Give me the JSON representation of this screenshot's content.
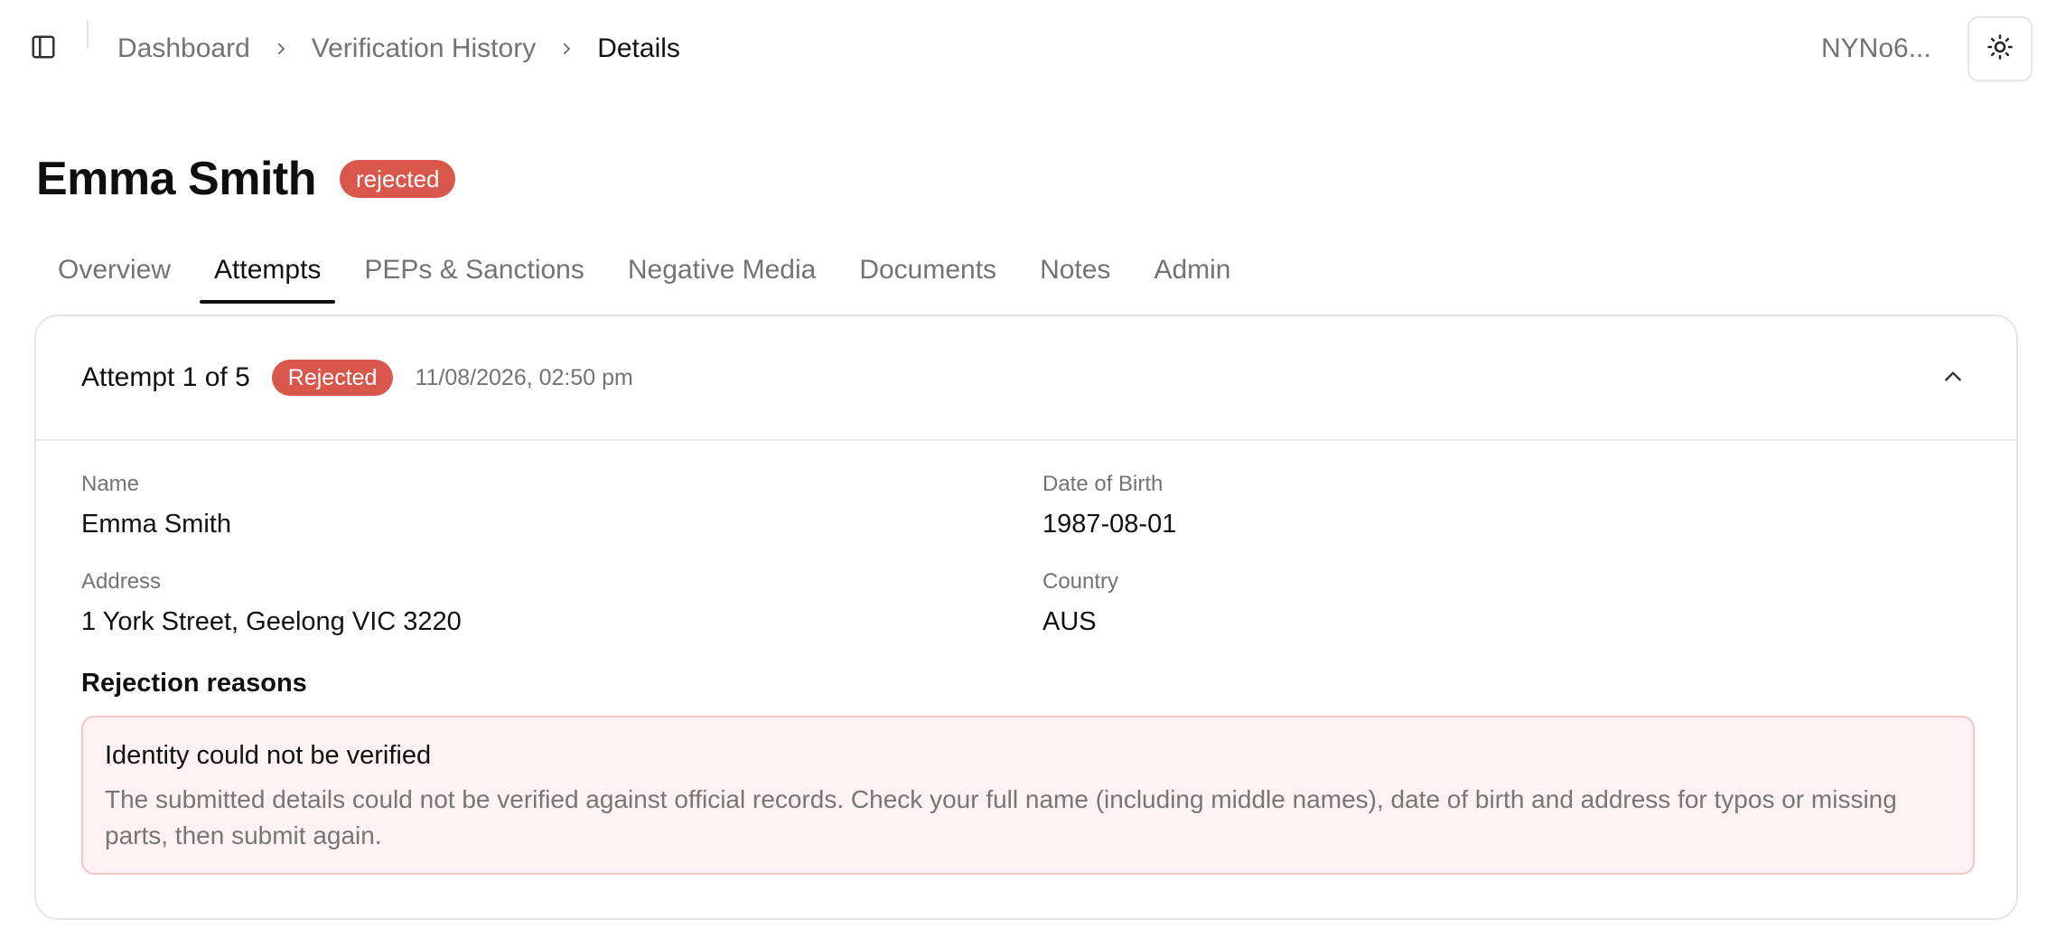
{
  "breadcrumb": {
    "items": [
      "Dashboard",
      "Verification History"
    ],
    "current": "Details"
  },
  "header": {
    "user_id": "NYNo6..."
  },
  "page": {
    "title": "Emma Smith",
    "status": "rejected"
  },
  "tabs": [
    {
      "label": "Overview",
      "active": false
    },
    {
      "label": "Attempts",
      "active": true
    },
    {
      "label": "PEPs & Sanctions",
      "active": false
    },
    {
      "label": "Negative Media",
      "active": false
    },
    {
      "label": "Documents",
      "active": false
    },
    {
      "label": "Notes",
      "active": false
    },
    {
      "label": "Admin",
      "active": false
    }
  ],
  "attempt": {
    "title": "Attempt 1 of 5",
    "status": "Rejected",
    "timestamp": "11/08/2026, 02:50 pm",
    "fields": {
      "name": {
        "label": "Name",
        "value": "Emma Smith"
      },
      "dob": {
        "label": "Date of Birth",
        "value": "1987-08-01"
      },
      "address": {
        "label": "Address",
        "value": "1 York Street, Geelong VIC 3220"
      },
      "country": {
        "label": "Country",
        "value": "AUS"
      }
    },
    "rejection": {
      "heading": "Rejection reasons",
      "title": "Identity could not be verified",
      "description": "The submitted details could not be verified against official records. Check your full name (including middle names), date of birth and address for typos or missing parts, then submit again."
    }
  },
  "colors": {
    "rejected_badge": "#d9574a",
    "reason_bg": "#fcf2f2",
    "reason_border": "#f3c7c7",
    "muted_text": "#737373"
  },
  "icons": {
    "sidebar_toggle": "sidebar-panel-icon",
    "breadcrumb_separator": "chevron-right-icon",
    "theme_toggle": "sun-icon",
    "collapse": "chevron-up-icon"
  }
}
